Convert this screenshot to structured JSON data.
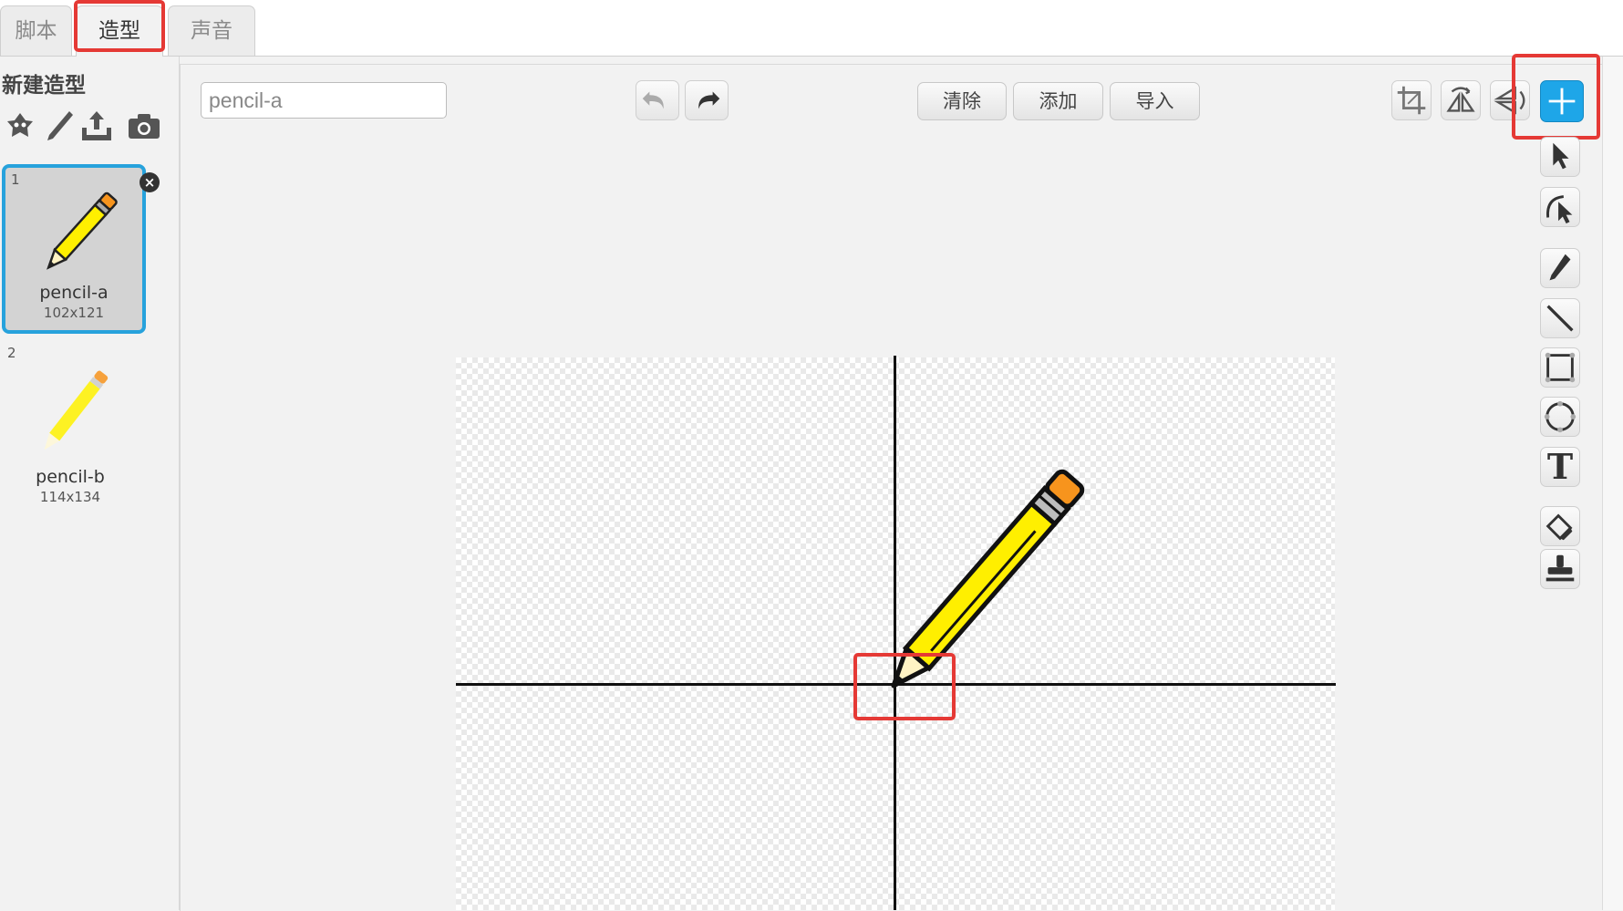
{
  "tabs": [
    {
      "label": "脚本",
      "active": false
    },
    {
      "label": "造型",
      "active": true
    },
    {
      "label": "声音",
      "active": false
    }
  ],
  "left_panel": {
    "new_costume_label": "新建造型",
    "tools": [
      "paint-brush-character-icon",
      "pencil-icon",
      "upload-icon",
      "camera-icon"
    ],
    "costumes": [
      {
        "index": "1",
        "name": "pencil-a",
        "size": "102x121",
        "selected": true
      },
      {
        "index": "2",
        "name": "pencil-b",
        "size": "114x134",
        "selected": false
      }
    ]
  },
  "editor": {
    "costume_name_value": "pencil-a",
    "buttons": {
      "clear": "清除",
      "add": "添加",
      "import": "导入"
    },
    "undo_icon": "undo-icon",
    "redo_icon": "redo-icon",
    "top_tools": [
      "crop-icon",
      "flip-horizontal-icon",
      "flip-vertical-icon",
      "set-center-icon"
    ],
    "side_tools": [
      "select-arrow-icon",
      "reshape-icon",
      "pencil-tool-icon",
      "line-tool-icon",
      "rectangle-tool-icon",
      "ellipse-tool-icon",
      "text-tool-icon",
      "fill-bucket-icon",
      "stamp-icon"
    ],
    "text_tool_glyph": "T"
  },
  "colors": {
    "accent": "#1ea6e8",
    "selected_border": "#27a2dc",
    "highlight": "#e53935",
    "pencil_yellow": "#ffef00",
    "eraser_orange": "#f7941d"
  }
}
